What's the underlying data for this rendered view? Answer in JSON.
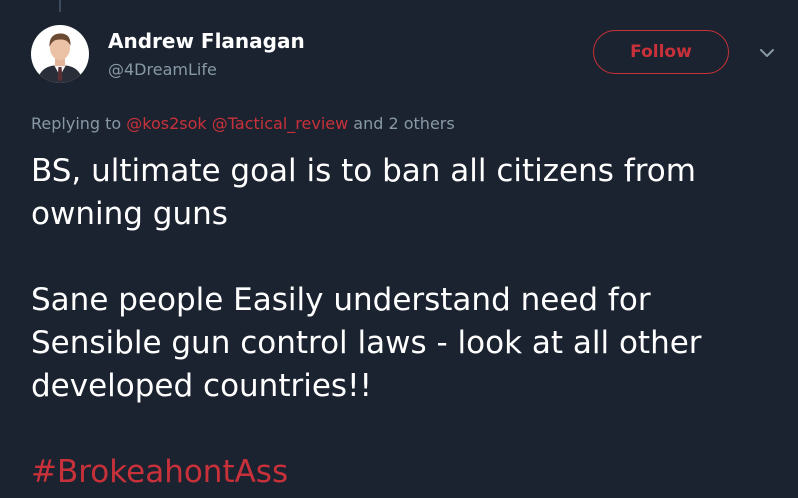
{
  "author": {
    "name": "Andrew Flanagan",
    "handle": "@4DreamLife"
  },
  "follow_button": {
    "label": "Follow"
  },
  "icons": {
    "more": "chevron-down-icon"
  },
  "reply_context": {
    "prefix": "Replying to",
    "mentions": [
      "@kos2sok",
      "@Tactical_review"
    ],
    "suffix": "and 2 others"
  },
  "tweet": {
    "paragraph1": "BS, ultimate goal is to ban all citizens from owning guns",
    "paragraph2": "Sane people Easily understand need for Sensible gun control laws - look at all other developed countries!!",
    "hashtag": "#BrokeahontAss"
  },
  "colors": {
    "background": "#1b2330",
    "accent": "#c9313a",
    "secondary_text": "#8899a6"
  }
}
